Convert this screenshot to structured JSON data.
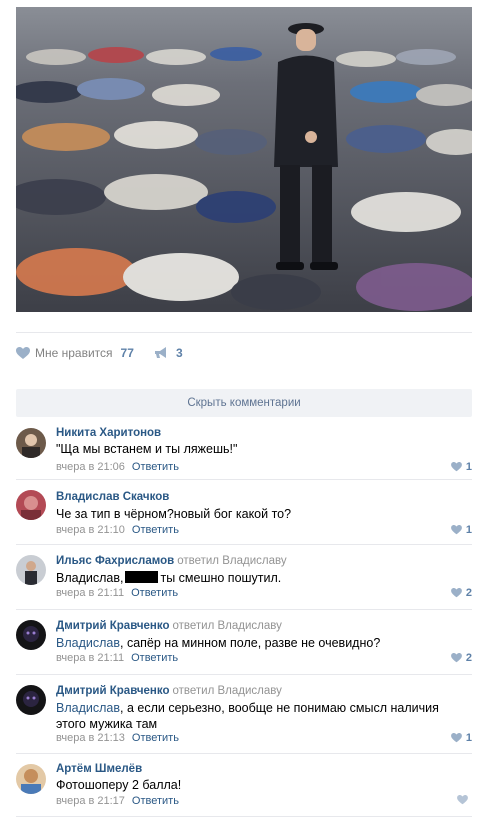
{
  "post": {
    "likes_label": "Мне нравится",
    "likes_count": "77",
    "shares_count": "3"
  },
  "comments_section": {
    "hide_label": "Скрыть комментарии"
  },
  "comments": [
    {
      "author": "Никита Харитонов",
      "reply_to": "",
      "text": "\"Ща мы встанем и ты ляжешь!\"",
      "time": "вчера в 21:06",
      "reply_label": "Ответить",
      "likes": "1"
    },
    {
      "author": "Владислав Скачков",
      "reply_to": "",
      "text": "Че за тип в чёрном?новый бог какой то?",
      "time": "вчера в 21:10",
      "reply_label": "Ответить",
      "likes": "1"
    },
    {
      "author": "Ильяс Фахрисламов",
      "reply_to": "ответил Владиславу",
      "mention": "Владислав,",
      "text_after": "ты смешно пошутил.",
      "time": "вчера в 21:11",
      "reply_label": "Ответить",
      "likes": "2"
    },
    {
      "author": "Дмитрий Кравченко",
      "reply_to": "ответил Владиславу",
      "mention": "Владислав",
      "text_after": ", сапёр на минном поле, разве не очевидно?",
      "time": "вчера в 21:11",
      "reply_label": "Ответить",
      "likes": "2"
    },
    {
      "author": "Дмитрий Кравченко",
      "reply_to": "ответил Владиславу",
      "mention": "Владислав",
      "text_after": ", а если серьезно, вообще не понимаю смысл наличия этого мужика там",
      "time": "вчера в 21:13",
      "reply_label": "Ответить",
      "likes": "1"
    },
    {
      "author": "Артём Шмелёв",
      "reply_to": "",
      "text": "Фотошоперу 2 балла!",
      "time": "вчера в 21:17",
      "reply_label": "Ответить",
      "likes": ""
    }
  ],
  "colors": {
    "link": "#2a5885",
    "muted": "#939393",
    "accent": "#5e81a8",
    "divider": "#e7e8ec"
  },
  "icons": [
    "heart-icon",
    "megaphone-icon"
  ]
}
